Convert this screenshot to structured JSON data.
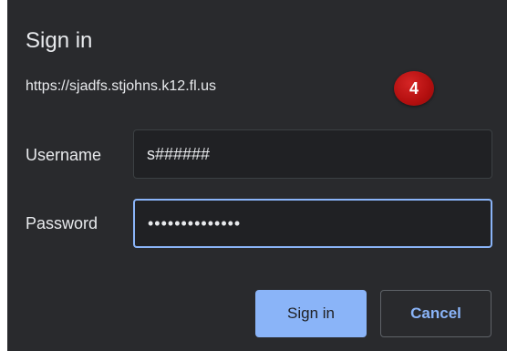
{
  "dialog": {
    "title": "Sign in",
    "origin": "https://sjadfs.stjohns.k12.fl.us",
    "step_badge": "4",
    "username": {
      "label": "Username",
      "value": "s######"
    },
    "password": {
      "label": "Password",
      "value": "••••••••••••••"
    },
    "buttons": {
      "sign_in": "Sign in",
      "cancel": "Cancel"
    }
  },
  "colors": {
    "dialog_bg": "#292a2d",
    "input_bg": "#202124",
    "accent": "#8ab4f8",
    "badge": "#b30f0f",
    "text": "#e8eaed"
  }
}
